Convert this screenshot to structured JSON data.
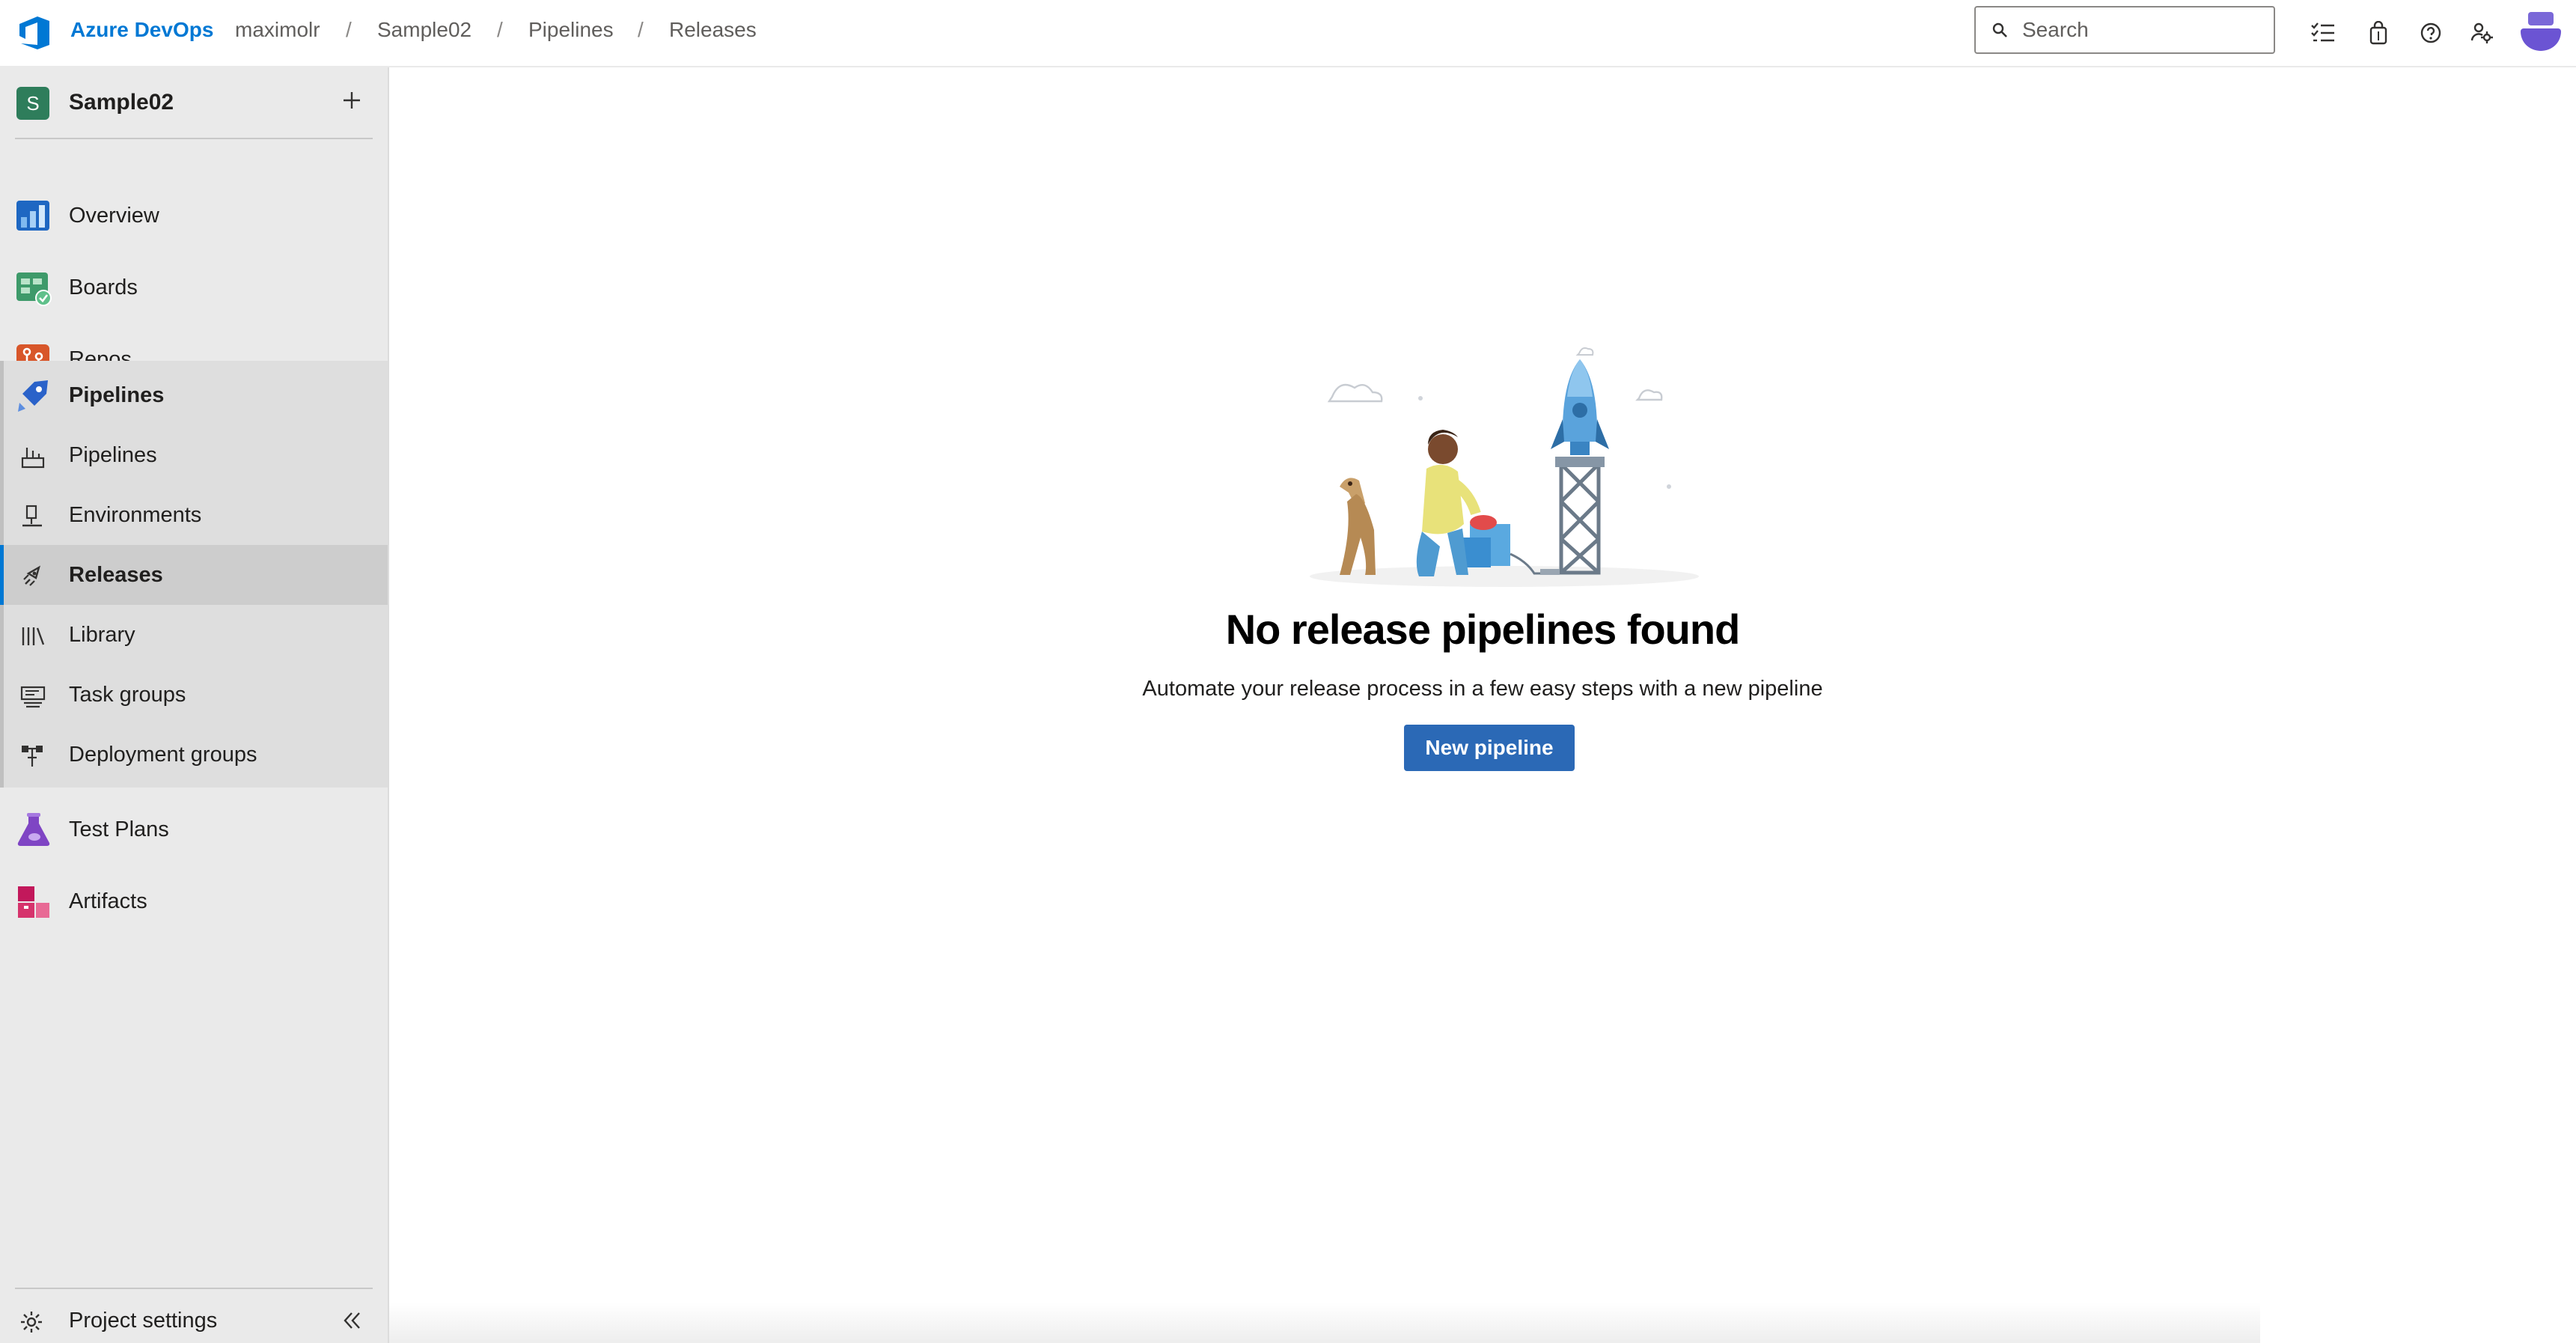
{
  "header": {
    "brand": "Azure DevOps",
    "breadcrumbs": [
      {
        "label": "maximolr"
      },
      {
        "label": "Sample02"
      },
      {
        "label": "Pipelines"
      },
      {
        "label": "Releases"
      }
    ],
    "separator": "/",
    "search_placeholder": "Search",
    "icons": [
      "search-icon",
      "task-list-icon",
      "marketplace-bag-icon",
      "help-icon",
      "user-settings-icon",
      "avatar"
    ]
  },
  "sidebar": {
    "project": {
      "initial": "S",
      "name": "Sample02",
      "badge_color": "#2e7d5b"
    },
    "items": [
      {
        "label": "Overview",
        "icon": "overview-icon"
      },
      {
        "label": "Boards",
        "icon": "boards-icon"
      },
      {
        "label": "Repos",
        "icon": "repos-icon"
      },
      {
        "label": "Pipelines",
        "icon": "pipelines-icon"
      },
      {
        "label": "Test Plans",
        "icon": "test-plans-icon"
      },
      {
        "label": "Artifacts",
        "icon": "artifacts-icon"
      }
    ],
    "pipelines_sub": [
      {
        "label": "Pipelines",
        "icon": "pipelines-sub-icon",
        "selected": false
      },
      {
        "label": "Environments",
        "icon": "environments-icon",
        "selected": false
      },
      {
        "label": "Releases",
        "icon": "releases-icon",
        "selected": true
      },
      {
        "label": "Library",
        "icon": "library-icon",
        "selected": false
      },
      {
        "label": "Task groups",
        "icon": "task-groups-icon",
        "selected": false
      },
      {
        "label": "Deployment groups",
        "icon": "deployment-groups-icon",
        "selected": false
      }
    ],
    "footer": {
      "settings_label": "Project settings"
    }
  },
  "main": {
    "empty_title": "No release pipelines found",
    "empty_subtitle": "Automate your release process in a few easy steps with a new pipeline",
    "primary_button": "New pipeline"
  },
  "colors": {
    "accent": "#0078d4",
    "primary_button": "#2b69b6",
    "sidebar_bg": "#eaeaea",
    "selected_bg": "#cdcdcd"
  }
}
